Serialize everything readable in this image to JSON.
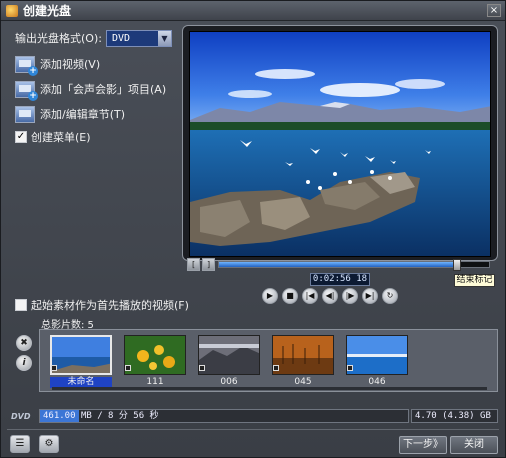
{
  "window": {
    "title": "创建光盘",
    "close_label": "×"
  },
  "format": {
    "label": "输出光盘格式(O):",
    "value": "DVD"
  },
  "actions": [
    {
      "label": "添加视频(V)",
      "icon": "add-video-icon"
    },
    {
      "label": "添加「会声会影」项目(A)",
      "icon": "add-project-icon"
    },
    {
      "label": "添加/编辑章节(T)",
      "icon": "chapter-icon"
    }
  ],
  "create_menu": {
    "label": "创建菜单(E)",
    "checked": true
  },
  "preview": {
    "timecode": "0:02:56 18",
    "tooltip": "结束标记",
    "progress": 0.88
  },
  "scrub_buttons": {
    "mark_in": "[",
    "mark_out": "]"
  },
  "transport": [
    "▶",
    "■",
    "|◀",
    "◀|",
    "|▶",
    "▶|",
    "↻"
  ],
  "first_play": {
    "label": "起始素材作为首先播放的视频(F)",
    "checked": false
  },
  "total": {
    "label": "总影片数: 5"
  },
  "side_buttons": {
    "delete": "✖",
    "info": "i"
  },
  "clips": [
    {
      "label": "未命名",
      "selected": true
    },
    {
      "label": "111",
      "selected": false
    },
    {
      "label": "006",
      "selected": false
    },
    {
      "label": "045",
      "selected": false
    },
    {
      "label": "046",
      "selected": false
    }
  ],
  "capacity": {
    "logo": "DVD",
    "used_mb": "461.00",
    "used_text": "MB  /  8 分 56 秒",
    "total": "4.70 (4.38) GB",
    "used_fraction": 0.105
  },
  "bottom": {
    "next": "下一步》",
    "close": "关闭",
    "menu_icon": "☰",
    "settings_icon": "⚙"
  }
}
